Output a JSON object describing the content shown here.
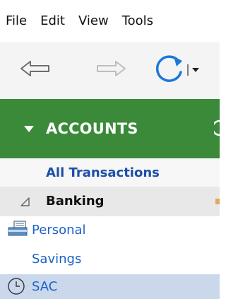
{
  "menu": {
    "items": [
      "File",
      "Edit",
      "View",
      "Tools"
    ]
  },
  "toolbar": {
    "back_icon": "back-arrow-icon",
    "forward_icon": "forward-arrow-icon",
    "refresh_icon": "refresh-icon",
    "dropdown_icon": "dropdown-arrow-icon"
  },
  "accounts": {
    "title": "ACCOUNTS",
    "header_color": "#3a8a39"
  },
  "sidebar": {
    "all_transactions": "All Transactions",
    "group": "Banking",
    "items": [
      {
        "line1": "Personal",
        "line2": "Savings",
        "icon": "bank-account-icon"
      },
      {
        "line1": "SAC",
        "icon": "clock-icon",
        "selected": true
      }
    ],
    "link_color": "#1d62c9",
    "selected_color": "#cbd8ec"
  }
}
